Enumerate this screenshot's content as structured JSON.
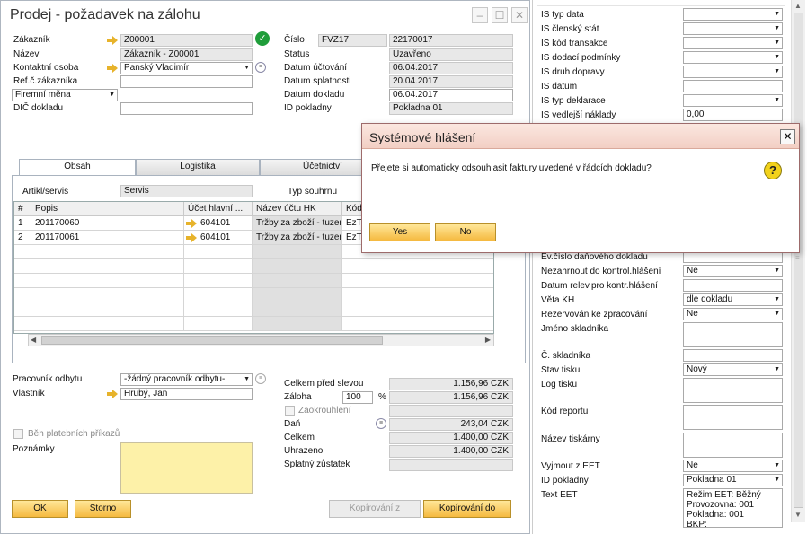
{
  "window": {
    "title": "Prodej - požadavek na zálohu"
  },
  "header": {
    "customer_label": "Zákazník",
    "customer_value": "Z00001",
    "name_label": "Název",
    "name_value": "Zákazník - Z00001",
    "contact_label": "Kontaktní osoba",
    "contact_value": "Panský Vladimír",
    "custref_label": "Ref.č.zákazníka",
    "custref_value": "",
    "currency_value": "Firemní měna",
    "vatdoc_label": "DIČ dokladu",
    "vatdoc_value": "",
    "number_label": "Číslo",
    "number_series": "FVZ17",
    "number_value": "22170017",
    "status_label": "Status",
    "status_value": "Uzavřeno",
    "postdate_label": "Datum účtování",
    "postdate_value": "06.04.2017",
    "duedate_label": "Datum splatnosti",
    "duedate_value": "20.04.2017",
    "docdate_label": "Datum dokladu",
    "docdate_value": "06.04.2017",
    "register_label": "ID pokladny",
    "register_value": "Pokladna 01"
  },
  "tabs": [
    {
      "label": "Obsah"
    },
    {
      "label": "Logistika"
    },
    {
      "label": "Účetnictví"
    }
  ],
  "content": {
    "itemtype_label": "Artikl/servis",
    "itemtype_value": "Servis",
    "summary_label": "Typ souhrnu",
    "columns": [
      "#",
      "Popis",
      "Účet hlavní ...",
      "Název účtu HK",
      "Kód"
    ],
    "rows": [
      {
        "num": "1",
        "desc": "201170060",
        "acct": "604101",
        "acct_name": "Tržby za zboží - tuzem",
        "code": "EzT"
      },
      {
        "num": "2",
        "desc": "201170061",
        "acct": "604101",
        "acct_name": "Tržby za zboží - tuzem",
        "code": "EzT"
      }
    ]
  },
  "footer": {
    "salesperson_label": "Pracovník odbytu",
    "salesperson_value": "-žádný pracovník odbytu-",
    "owner_label": "Vlastník",
    "owner_value": "Hrubý, Jan",
    "payrun_label": "Běh platebních příkazů",
    "remarks_label": "Poznámky",
    "remarks_value": "",
    "before_disc_label": "Celkem před slevou",
    "before_disc_value": "1.156,96 CZK",
    "deposit_label": "Záloha",
    "deposit_pct": "100",
    "pct_sign": "%",
    "deposit_value": "1.156,96 CZK",
    "rounding_label": "Zaokrouhlení",
    "tax_label": "Daň",
    "tax_value": "243,04 CZK",
    "total_label": "Celkem",
    "total_value": "1.400,00 CZK",
    "paid_label": "Uhrazeno",
    "paid_value": "1.400,00 CZK",
    "balance_label": "Splatný zůstatek",
    "balance_value": ""
  },
  "buttons": {
    "ok": "OK",
    "cancel": "Storno",
    "copy_from": "Kopírování z",
    "copy_to": "Kopírování do"
  },
  "right_panel": {
    "fields": [
      {
        "label": "IS typ data",
        "value": ""
      },
      {
        "label": "IS členský stát",
        "value": ""
      },
      {
        "label": "IS kód transakce",
        "value": ""
      },
      {
        "label": "IS dodací podmínky",
        "value": ""
      },
      {
        "label": "IS druh dopravy",
        "value": ""
      },
      {
        "label": "IS datum",
        "value": ""
      },
      {
        "label": "IS typ deklarace",
        "value": ""
      },
      {
        "label": "IS vedlejší náklady",
        "value": "0,00"
      }
    ],
    "lower": [
      {
        "label": "Ev.číslo daňového dokladu",
        "value": ""
      },
      {
        "label": "Nezahrnout do kontrol.hlášení",
        "value": "Ne"
      },
      {
        "label": "Datum relev.pro kontr.hlášení",
        "value": ""
      },
      {
        "label": "Věta KH",
        "value": "dle dokladu"
      },
      {
        "label": "Rezervován ke zpracování",
        "value": "Ne"
      },
      {
        "label": "Jméno skladníka",
        "value": ""
      },
      {
        "label": "Č. skladníka",
        "value": ""
      },
      {
        "label": "Stav tisku",
        "value": "Nový"
      },
      {
        "label": "Log tisku",
        "value": ""
      },
      {
        "label": "Kód reportu",
        "value": ""
      },
      {
        "label": "Název tiskárny",
        "value": ""
      },
      {
        "label": "Vyjmout z EET",
        "value": "Ne"
      },
      {
        "label": "ID pokladny",
        "value": "Pokladna 01"
      },
      {
        "label": "Text EET",
        "value": ""
      }
    ],
    "eet_lines": [
      "Režim EET: Běžný",
      "Provozovna: 001",
      "Pokladna: 001",
      "BKP:"
    ]
  },
  "dialog": {
    "title": "Systémové hlášení",
    "message": "Přejete si automaticky odsouhlasit faktury uvedené v řádcích dokladu?",
    "yes": "Yes",
    "no": "No"
  },
  "colors": {
    "accent": "#f5b940",
    "ok_check": "#1f9d3a",
    "dialog_title": "#f2cfc4",
    "notes": "#fdf1a8"
  }
}
